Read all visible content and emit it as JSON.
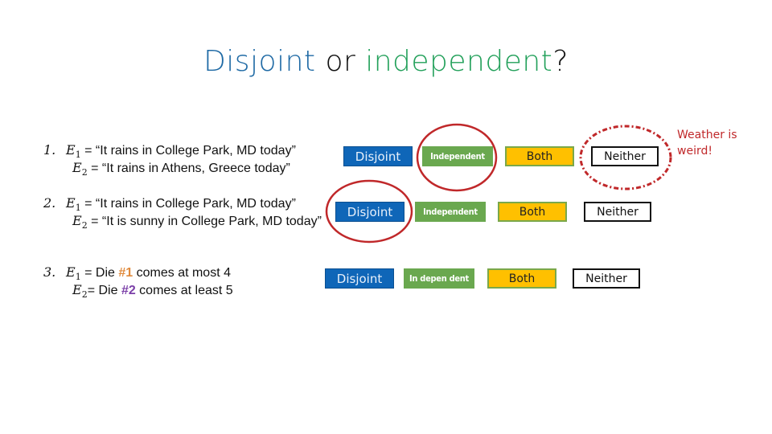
{
  "title": {
    "part1": "Disjoint",
    "part2": " or ",
    "part3": "independent",
    "part4": "?"
  },
  "items": [
    {
      "number": "1.",
      "e1_var": "E",
      "e1_sub": "1",
      "e1_text": " = “It rains in College Park, MD today”",
      "e2_var": "E",
      "e2_sub": "2",
      "e2_text": " = “It rains in Athens, Greece today”"
    },
    {
      "number": "2.",
      "e1_var": "E",
      "e1_sub": "1",
      "e1_text": " = “It rains in College Park, MD today”",
      "e2_var": "E",
      "e2_sub": "2",
      "e2_text": " = “It is sunny in College Park, MD today”"
    },
    {
      "number": "3.",
      "e1_var": "E",
      "e1_sub": "1",
      "e1_pre": " = Die ",
      "e1_hl": "#1",
      "e1_post": " comes at most 4",
      "e2_var": "E",
      "e2_sub": "2",
      "e2_pre": "= Die ",
      "e2_hl": "#2",
      "e2_post": " comes at least 5"
    }
  ],
  "options": {
    "disjoint": "Disjoint",
    "independent": "Independent",
    "independent_row3": "In depen dent",
    "both": "Both",
    "neither": "Neither"
  },
  "annotation": {
    "line1": "Weather is",
    "line2": "weird!"
  },
  "colors": {
    "title_blue": "#1f6aa5",
    "title_green": "#22a05a",
    "disjoint_bg": "#0f66b8",
    "independent_bg": "#6aa84f",
    "both_bg": "#ffc000",
    "circle_red": "#c0282a"
  }
}
